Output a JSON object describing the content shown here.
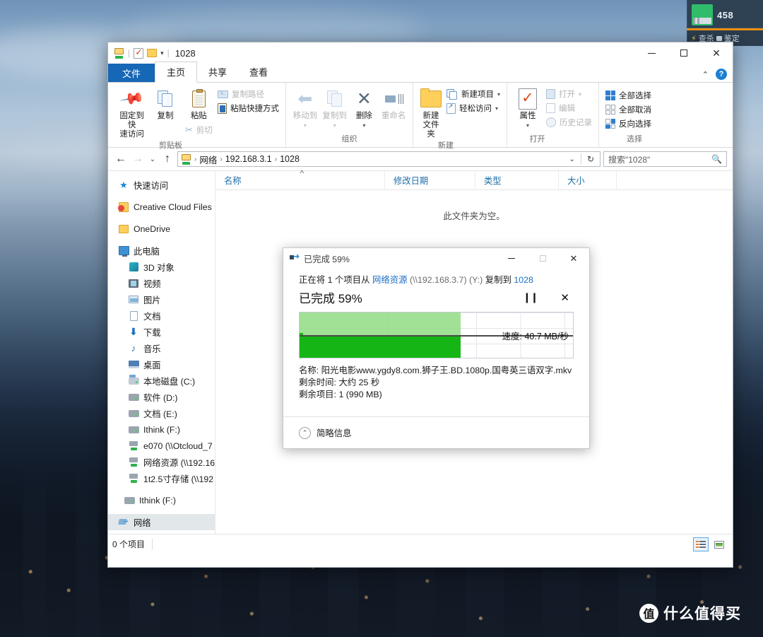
{
  "desktop": {
    "security_widget": {
      "count": "458",
      "icon": "drive-icon",
      "toolbar": [
        {
          "icon": "bolt-icon",
          "label": "查杀"
        },
        {
          "icon": "shield-icon",
          "label": "鉴定"
        }
      ]
    },
    "watermark": {
      "badge": "值",
      "text": "什么值得买"
    }
  },
  "explorer": {
    "title": "1028",
    "quick_access_toolbar": [
      {
        "name": "network-pc-icon"
      },
      {
        "name": "properties-icon"
      },
      {
        "name": "new-folder-icon"
      },
      {
        "name": "customize-caret"
      }
    ],
    "window_buttons": {
      "minimize": "—",
      "maximize": "▢",
      "close": "✕"
    },
    "tabs": [
      {
        "label": "文件",
        "kind": "file"
      },
      {
        "label": "主页",
        "kind": "active"
      },
      {
        "label": "共享",
        "kind": "normal"
      },
      {
        "label": "查看",
        "kind": "normal"
      }
    ],
    "tabs_right": {
      "collapse": "⌃",
      "help": "?"
    },
    "ribbon": {
      "groups": [
        {
          "label": "剪贴板",
          "big": [
            {
              "label": "固定到快\n速访问",
              "icon": "pin-icon",
              "dim": false
            },
            {
              "label": "复制",
              "icon": "copy-icon",
              "dim": false
            },
            {
              "label": "粘贴",
              "icon": "paste-icon",
              "dim": false
            }
          ],
          "small": [
            {
              "label": "复制路径",
              "icon": "copy-path-icon",
              "dim": true
            },
            {
              "label": "粘贴快捷方式",
              "icon": "paste-shortcut-icon",
              "dim": false
            },
            {
              "label": "剪切",
              "icon": "cut-icon",
              "dim": true
            }
          ]
        },
        {
          "label": "组织",
          "big": [
            {
              "label": "移动到",
              "icon": "move-to-icon",
              "dim": true,
              "caret": true
            },
            {
              "label": "复制到",
              "icon": "copy-to-icon",
              "dim": true,
              "caret": true
            },
            {
              "label": "删除",
              "icon": "delete-icon",
              "dim": false,
              "caret": true
            },
            {
              "label": "重命名",
              "icon": "rename-icon",
              "dim": true
            }
          ],
          "small": []
        },
        {
          "label": "新建",
          "big": [
            {
              "label": "新建\n文件夹",
              "icon": "new-folder-icon",
              "dim": false
            }
          ],
          "small": [
            {
              "label": "新建项目",
              "icon": "new-item-icon",
              "dim": false,
              "caret": true
            },
            {
              "label": "轻松访问",
              "icon": "easy-access-icon",
              "dim": false,
              "caret": true
            }
          ]
        },
        {
          "label": "打开",
          "big": [
            {
              "label": "属性",
              "icon": "properties-icon",
              "dim": false,
              "caret": true
            }
          ],
          "small": [
            {
              "label": "打开",
              "icon": "open-icon",
              "dim": true,
              "caret": true
            },
            {
              "label": "编辑",
              "icon": "edit-icon",
              "dim": true
            },
            {
              "label": "历史记录",
              "icon": "history-icon",
              "dim": true
            }
          ]
        },
        {
          "label": "选择",
          "big": [],
          "small": [
            {
              "label": "全部选择",
              "icon": "select-all-icon",
              "dim": false
            },
            {
              "label": "全部取消",
              "icon": "select-none-icon",
              "dim": false
            },
            {
              "label": "反向选择",
              "icon": "invert-selection-icon",
              "dim": false
            }
          ]
        }
      ]
    },
    "address_bar": {
      "back": "←",
      "forward": "→",
      "recent": "⌄",
      "up": "↑",
      "breadcrumbs": [
        "网络",
        "192.168.3.1",
        "1028"
      ],
      "dropdown": "⌄",
      "refresh": "↻"
    },
    "search": {
      "value": "搜索\"1028\"",
      "placeholder": "搜索\"1028\"",
      "icon": "search-icon"
    },
    "nav_pane": [
      {
        "label": "快速访问",
        "icon": "star-icon",
        "indent": 0
      },
      {
        "label": "Creative Cloud Files",
        "icon": "creative-cloud-icon",
        "indent": 0
      },
      {
        "label": "OneDrive",
        "icon": "onedrive-folder-icon",
        "indent": 0
      },
      {
        "label": "此电脑",
        "icon": "this-pc-icon",
        "indent": 0
      },
      {
        "label": "3D 对象",
        "icon": "3d-objects-icon",
        "indent": 1
      },
      {
        "label": "视频",
        "icon": "videos-icon",
        "indent": 1
      },
      {
        "label": "图片",
        "icon": "pictures-icon",
        "indent": 1
      },
      {
        "label": "文档",
        "icon": "documents-icon",
        "indent": 1
      },
      {
        "label": "下载",
        "icon": "downloads-icon",
        "indent": 1
      },
      {
        "label": "音乐",
        "icon": "music-icon",
        "indent": 1
      },
      {
        "label": "桌面",
        "icon": "desktop-icon",
        "indent": 1
      },
      {
        "label": "本地磁盘 (C:)",
        "icon": "system-drive-icon",
        "indent": 1
      },
      {
        "label": "软件 (D:)",
        "icon": "drive-icon",
        "indent": 1
      },
      {
        "label": "文档 (E:)",
        "icon": "drive-icon",
        "indent": 1
      },
      {
        "label": "Ithink (F:)",
        "icon": "drive-icon",
        "indent": 1
      },
      {
        "label": "e070 (\\\\Otcloud_7",
        "icon": "network-drive-icon",
        "indent": 1
      },
      {
        "label": "网络资源 (\\\\192.16",
        "icon": "network-drive-icon",
        "indent": 1
      },
      {
        "label": "1t2.5寸存储 (\\\\192",
        "icon": "network-drive-icon",
        "indent": 1
      },
      {
        "label": "Ithink (F:)",
        "icon": "drive-icon",
        "indent": 0
      },
      {
        "label": "网络",
        "icon": "network-icon",
        "indent": 0,
        "selected": true
      }
    ],
    "columns": [
      {
        "label": "名称",
        "sorted": true
      },
      {
        "label": "修改日期",
        "sorted": false
      },
      {
        "label": "类型",
        "sorted": false
      },
      {
        "label": "大小",
        "sorted": false
      }
    ],
    "empty_message": "此文件夹为空。",
    "status": {
      "item_count": "0 个项目"
    },
    "view_buttons": [
      {
        "name": "details-view-button",
        "active": true
      },
      {
        "name": "large-icons-view-button",
        "active": false
      }
    ]
  },
  "copy_dialog": {
    "title": "已完成 59%",
    "window_buttons": {
      "minimize": "—",
      "maximize": "▢",
      "close": "✕"
    },
    "headline": {
      "prefix": "正在将 1 个项目从",
      "source_name": "网络资源",
      "source_path": "(\\\\192.168.3.7) (Y:)",
      "middle": "复制到",
      "destination": "1028"
    },
    "percent_text": "已完成 59%",
    "percent_value": 59,
    "pause_icon": "pause-icon",
    "cancel_icon": "cancel-icon",
    "speed_label": "速度: 40.7 MB/秒",
    "details": [
      "名称: 阳光电影www.ygdy8.com.狮子王.BD.1080p.国粤英三语双字.mkv",
      "剩余时间: 大约 25 秒",
      "剩余项目: 1 (990 MB)"
    ],
    "footer": {
      "toggle_icon": "chevron-up-circle-icon",
      "label": "简略信息"
    },
    "colors": {
      "area_light": "#8fdc83",
      "area_dark": "#16b516",
      "link": "#1b6fc4"
    }
  }
}
